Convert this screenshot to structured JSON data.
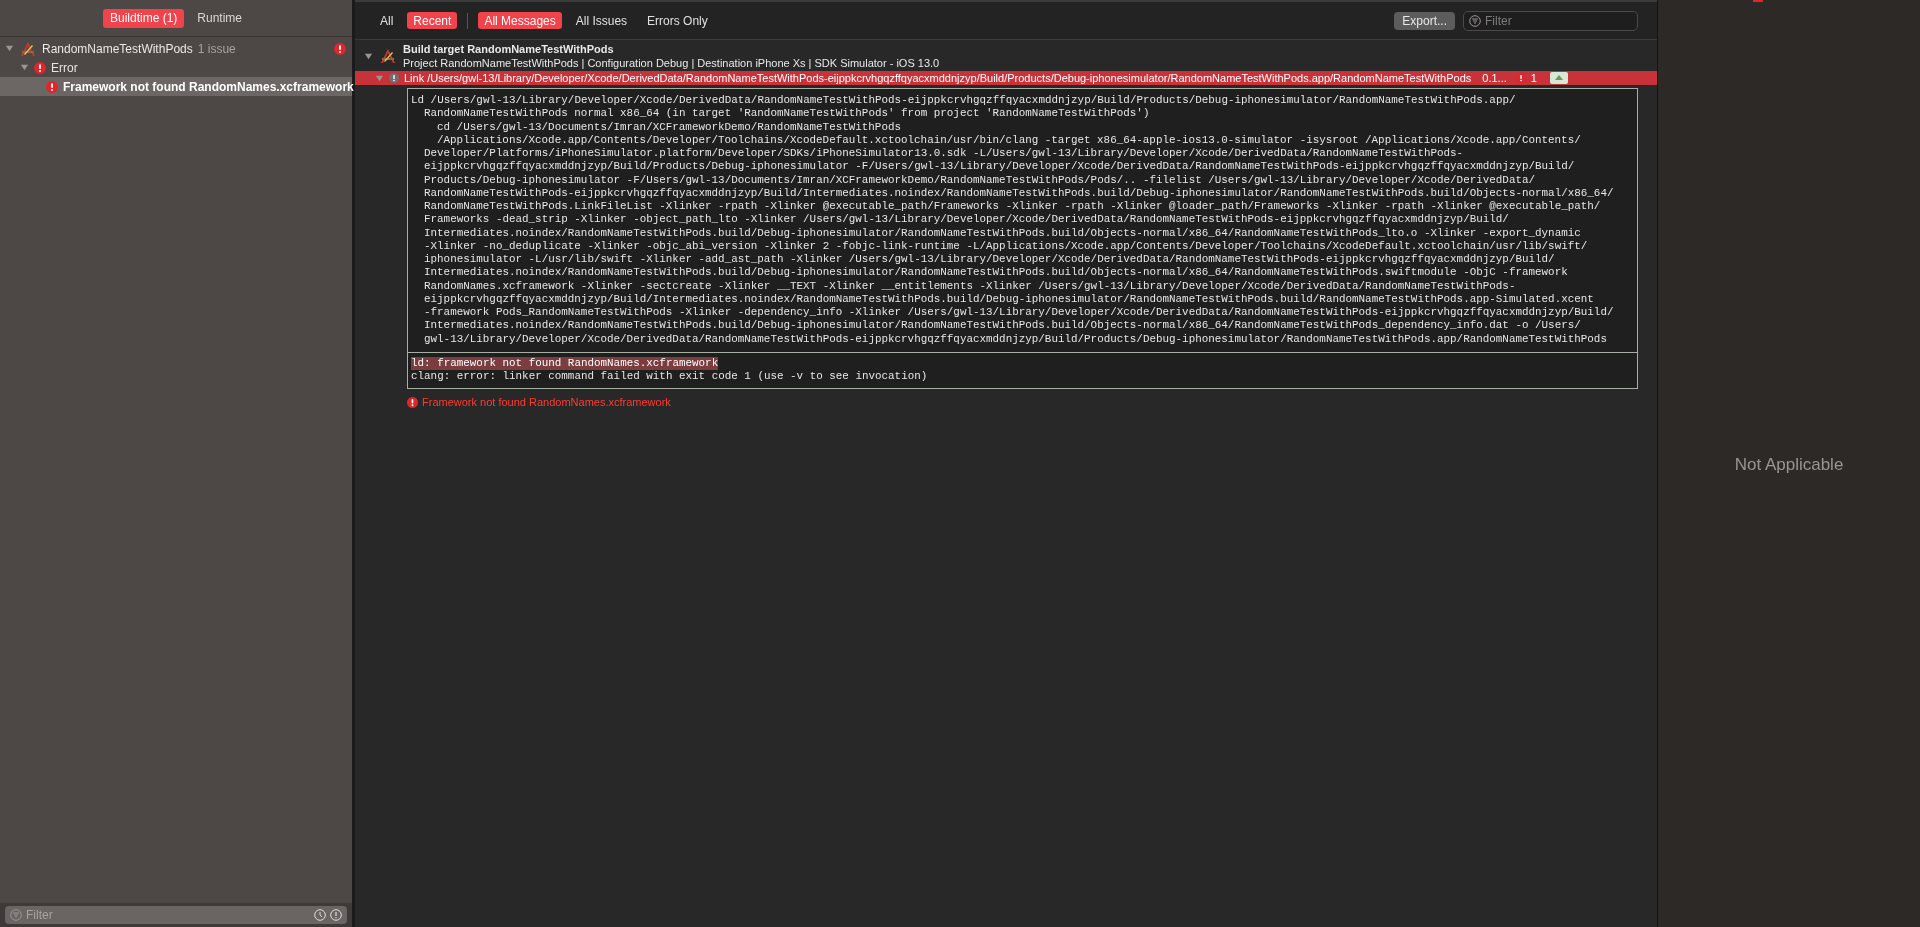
{
  "sidebar": {
    "tabs": [
      {
        "label": "Buildtime (1)",
        "selected": true
      },
      {
        "label": "Runtime",
        "selected": false
      }
    ],
    "tree": [
      {
        "kind": "target",
        "label": "RandomNameTestWithPods",
        "count": "1 issue",
        "expanded": true,
        "selected": false,
        "children": [
          {
            "kind": "group",
            "label": "Error",
            "expanded": true,
            "selected": false,
            "children": [
              {
                "kind": "issue",
                "label": "Framework not found RandomNames.xcframework",
                "selected": true
              }
            ]
          }
        ]
      }
    ],
    "filter": {
      "placeholder": "Filter"
    }
  },
  "toolbar": {
    "scope_tabs": [
      {
        "label": "All",
        "selected": false
      },
      {
        "label": "Recent",
        "selected": true
      }
    ],
    "filter_tabs": [
      {
        "label": "All Messages",
        "selected": true
      },
      {
        "label": "All Issues",
        "selected": false
      },
      {
        "label": "Errors Only",
        "selected": false
      }
    ],
    "export_button": "Export...",
    "filter": {
      "placeholder": "Filter"
    }
  },
  "log": {
    "target": {
      "title": "Build target RandomNameTestWithPods",
      "subtitle": "Project RandomNameTestWithPods | Configuration Debug | Destination iPhone Xs | SDK Simulator - iOS 13.0",
      "expanded": true
    },
    "step": {
      "title": "Link /Users/gwl-13/Library/Developer/Xcode/DerivedData/RandomNameTestWithPods-eijppkcrvhgqzffqyacxmddnjzyp/Build/Products/Debug-iphonesimulator/RandomNameTestWithPods.app/RandomNameTestWithPods",
      "duration": "0.1...",
      "issue_count": "1",
      "expanded": true
    },
    "lines": [
      {
        "kind": "first",
        "text": "Ld /Users/gwl-13/Library/Developer/Xcode/DerivedData/RandomNameTestWithPods-eijppkcrvhgqzffqyacxmddnjzyp/Build/Products/Debug-iphonesimulator/RandomNameTestWithPods.app/"
      },
      {
        "kind": "cont",
        "text": "RandomNameTestWithPods normal x86_64 (in target 'RandomNameTestWithPods' from project 'RandomNameTestWithPods')"
      },
      {
        "kind": "nested",
        "text": "cd /Users/gwl-13/Documents/Imran/XCFrameworkDemo/RandomNameTestWithPods"
      },
      {
        "kind": "nested",
        "text": "/Applications/Xcode.app/Contents/Developer/Toolchains/XcodeDefault.xctoolchain/usr/bin/clang -target x86_64-apple-ios13.0-simulator -isysroot /Applications/Xcode.app/Contents/"
      },
      {
        "kind": "cont",
        "text": "Developer/Platforms/iPhoneSimulator.platform/Developer/SDKs/iPhoneSimulator13.0.sdk -L/Users/gwl-13/Library/Developer/Xcode/DerivedData/RandomNameTestWithPods-"
      },
      {
        "kind": "cont",
        "text": "eijppkcrvhgqzffqyacxmddnjzyp/Build/Products/Debug-iphonesimulator -F/Users/gwl-13/Library/Developer/Xcode/DerivedData/RandomNameTestWithPods-eijppkcrvhgqzffqyacxmddnjzyp/Build/"
      },
      {
        "kind": "cont",
        "text": "Products/Debug-iphonesimulator -F/Users/gwl-13/Documents/Imran/XCFrameworkDemo/RandomNameTestWithPods/Pods/.. -filelist /Users/gwl-13/Library/Developer/Xcode/DerivedData/"
      },
      {
        "kind": "cont",
        "text": "RandomNameTestWithPods-eijppkcrvhgqzffqyacxmddnjzyp/Build/Intermediates.noindex/RandomNameTestWithPods.build/Debug-iphonesimulator/RandomNameTestWithPods.build/Objects-normal/x86_64/"
      },
      {
        "kind": "cont",
        "text": "RandomNameTestWithPods.LinkFileList -Xlinker -rpath -Xlinker @executable_path/Frameworks -Xlinker -rpath -Xlinker @loader_path/Frameworks -Xlinker -rpath -Xlinker @executable_path/"
      },
      {
        "kind": "cont",
        "text": "Frameworks -dead_strip -Xlinker -object_path_lto -Xlinker /Users/gwl-13/Library/Developer/Xcode/DerivedData/RandomNameTestWithPods-eijppkcrvhgqzffqyacxmddnjzyp/Build/"
      },
      {
        "kind": "cont",
        "text": "Intermediates.noindex/RandomNameTestWithPods.build/Debug-iphonesimulator/RandomNameTestWithPods.build/Objects-normal/x86_64/RandomNameTestWithPods_lto.o -Xlinker -export_dynamic"
      },
      {
        "kind": "cont",
        "text": "-Xlinker -no_deduplicate -Xlinker -objc_abi_version -Xlinker 2 -fobjc-link-runtime -L/Applications/Xcode.app/Contents/Developer/Toolchains/XcodeDefault.xctoolchain/usr/lib/swift/"
      },
      {
        "kind": "cont",
        "text": "iphonesimulator -L/usr/lib/swift -Xlinker -add_ast_path -Xlinker /Users/gwl-13/Library/Developer/Xcode/DerivedData/RandomNameTestWithPods-eijppkcrvhgqzffqyacxmddnjzyp/Build/"
      },
      {
        "kind": "cont",
        "text": "Intermediates.noindex/RandomNameTestWithPods.build/Debug-iphonesimulator/RandomNameTestWithPods.build/Objects-normal/x86_64/RandomNameTestWithPods.swiftmodule -ObjC -framework"
      },
      {
        "kind": "cont",
        "text": "RandomNames.xcframework -Xlinker -sectcreate -Xlinker __TEXT -Xlinker __entitlements -Xlinker /Users/gwl-13/Library/Developer/Xcode/DerivedData/RandomNameTestWithPods-"
      },
      {
        "kind": "cont",
        "text": "eijppkcrvhgqzffqyacxmddnjzyp/Build/Intermediates.noindex/RandomNameTestWithPods.build/Debug-iphonesimulator/RandomNameTestWithPods.build/RandomNameTestWithPods.app-Simulated.xcent"
      },
      {
        "kind": "cont",
        "text": "-framework Pods_RandomNameTestWithPods -Xlinker -dependency_info -Xlinker /Users/gwl-13/Library/Developer/Xcode/DerivedData/RandomNameTestWithPods-eijppkcrvhgqzffqyacxmddnjzyp/Build/"
      },
      {
        "kind": "cont",
        "text": "Intermediates.noindex/RandomNameTestWithPods.build/Debug-iphonesimulator/RandomNameTestWithPods.build/Objects-normal/x86_64/RandomNameTestWithPods_dependency_info.dat -o /Users/"
      },
      {
        "kind": "cont",
        "text": "gwl-13/Library/Developer/Xcode/DerivedData/RandomNameTestWithPods-eijppkcrvhgqzffqyacxmddnjzyp/Build/Products/Debug-iphonesimulator/RandomNameTestWithPods.app/RandomNameTestWithPods"
      }
    ],
    "output": [
      {
        "text": "ld: framework not found RandomNames.xcframework",
        "highlighted": true
      },
      {
        "text": "clang: error: linker command failed with exit code 1 (use -v to see invocation)",
        "highlighted": false
      }
    ],
    "issue": "Framework not found RandomNames.xcframework"
  },
  "inspector": {
    "message": "Not Applicable"
  }
}
